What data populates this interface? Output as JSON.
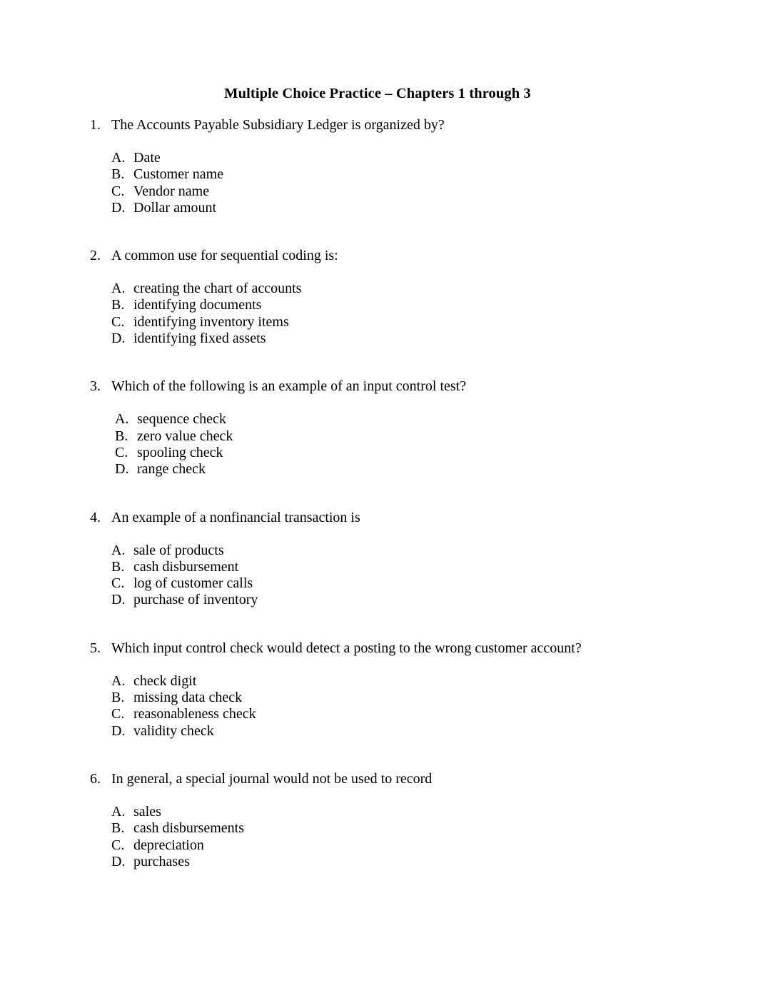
{
  "document": {
    "title": "Multiple Choice Practice – Chapters 1 through 3",
    "background_color": "#ffffff",
    "text_color": "#000000",
    "questions": [
      {
        "number": "1.",
        "text": "The Accounts Payable Subsidiary Ledger is organized by?",
        "options": [
          {
            "letter": "A.",
            "text": "Date"
          },
          {
            "letter": "B.",
            "text": "Customer name"
          },
          {
            "letter": "C.",
            "text": "Vendor name"
          },
          {
            "letter": "D.",
            "text": "Dollar amount"
          }
        ]
      },
      {
        "number": "2.",
        "text": "A common use for sequential coding is:",
        "options": [
          {
            "letter": "A.",
            "text": "creating the chart of accounts"
          },
          {
            "letter": "B.",
            "text": "identifying documents"
          },
          {
            "letter": "C.",
            "text": "identifying inventory items"
          },
          {
            "letter": "D.",
            "text": "identifying fixed assets"
          }
        ]
      },
      {
        "number": "3.",
        "text": "Which of the following is an example of an input control test?",
        "options": [
          {
            "letter": "A.",
            "text": "sequence check"
          },
          {
            "letter": "B.",
            "text": "zero value check"
          },
          {
            "letter": "C.",
            "text": "spooling check"
          },
          {
            "letter": "D.",
            "text": "range check"
          }
        ]
      },
      {
        "number": "4.",
        "text": "An example of a nonfinancial transaction is",
        "options": [
          {
            "letter": "A.",
            "text": "sale of products"
          },
          {
            "letter": "B.",
            "text": "cash disbursement"
          },
          {
            "letter": "C.",
            "text": "log of customer calls"
          },
          {
            "letter": "D.",
            "text": "purchase of inventory"
          }
        ]
      },
      {
        "number": "5.",
        "text": "Which input control check would detect a posting to the wrong customer account?",
        "options": [
          {
            "letter": "A.",
            "text": "check digit"
          },
          {
            "letter": "B.",
            "text": "missing data check"
          },
          {
            "letter": "C.",
            "text": "reasonableness check"
          },
          {
            "letter": "D.",
            "text": "validity check"
          }
        ]
      },
      {
        "number": "6.",
        "text": "In general, a special journal would not be used to record",
        "options": [
          {
            "letter": "A.",
            "text": "sales"
          },
          {
            "letter": "B.",
            "text": "cash disbursements"
          },
          {
            "letter": "C.",
            "text": "depreciation"
          },
          {
            "letter": "D.",
            "text": "purchases"
          }
        ]
      }
    ]
  }
}
